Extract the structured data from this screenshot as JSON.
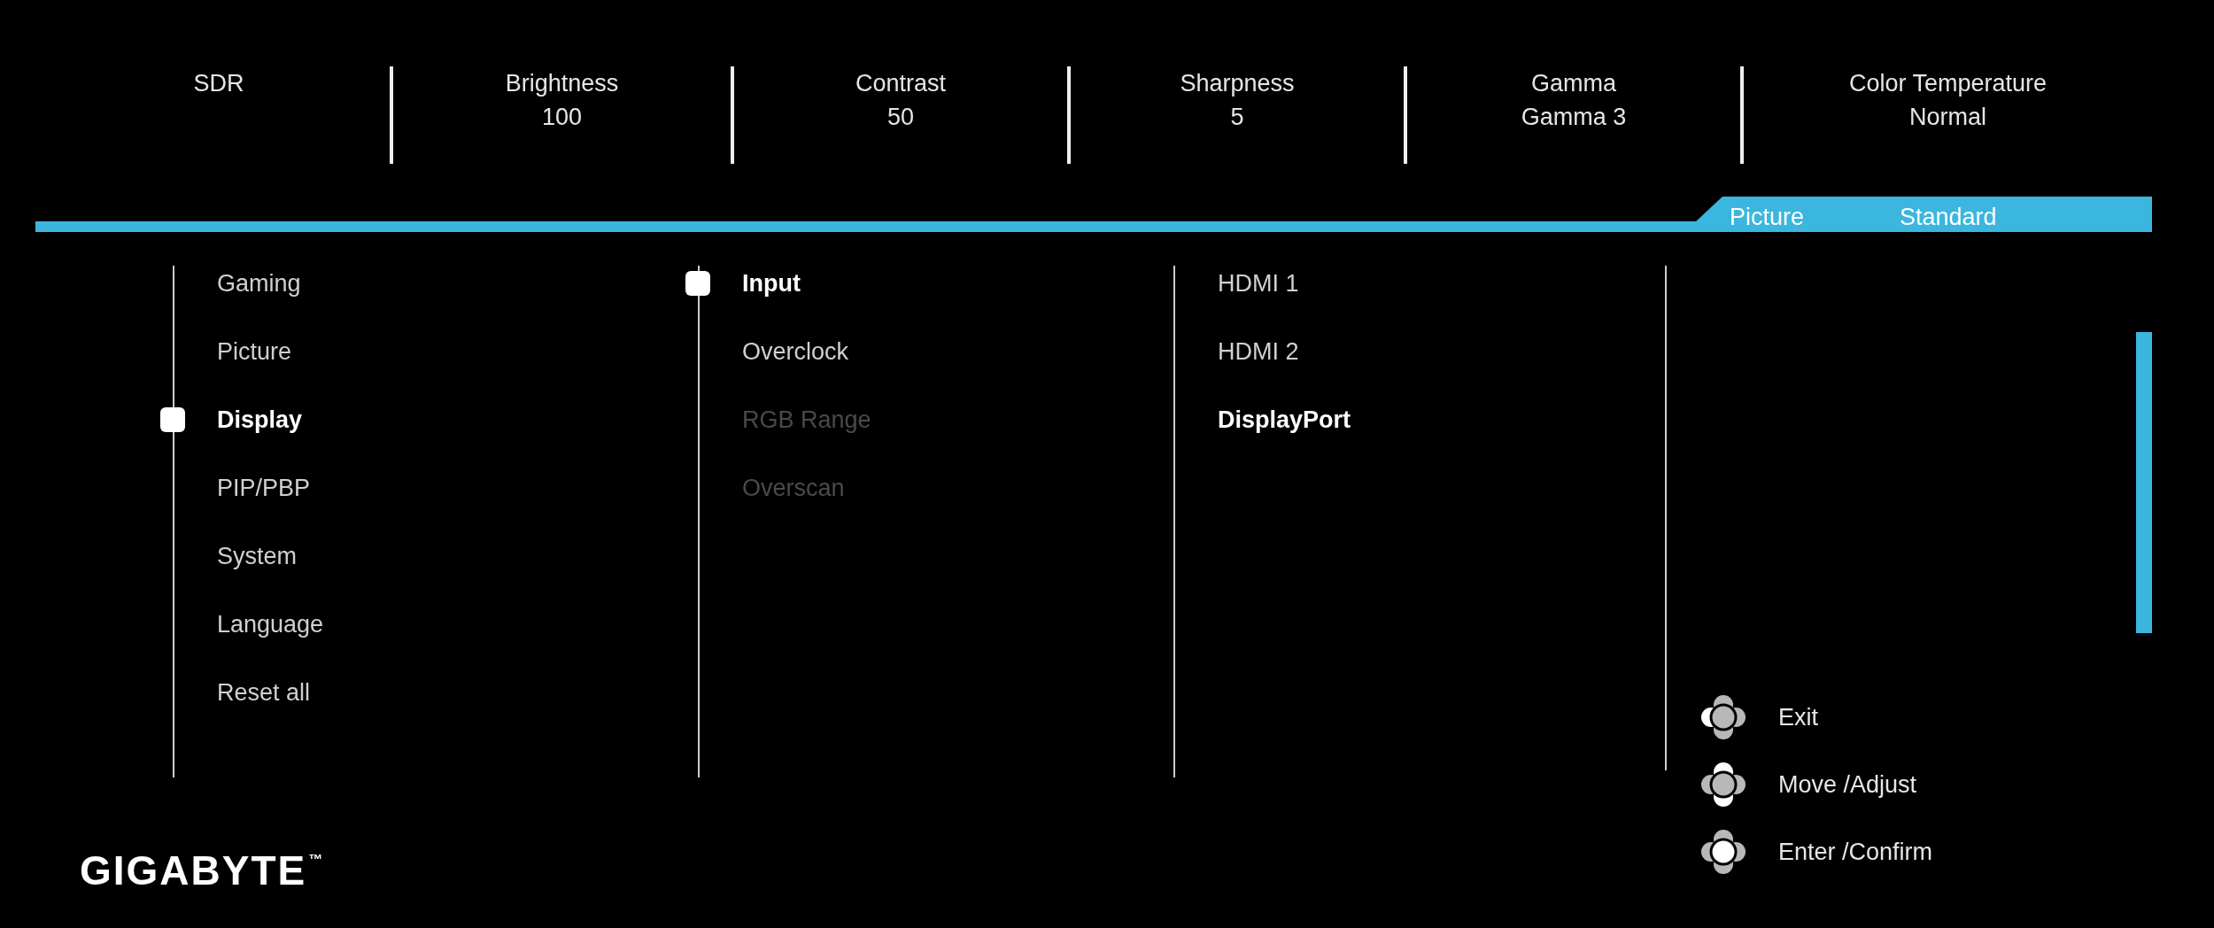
{
  "top_bar": [
    {
      "label": "SDR"
    },
    {
      "label": "Brightness",
      "value": "100"
    },
    {
      "label": "Contrast",
      "value": "50"
    },
    {
      "label": "Sharpness",
      "value": "5"
    },
    {
      "label": "Gamma",
      "value": "Gamma 3"
    },
    {
      "label": "Color Temperature",
      "value": "Normal"
    }
  ],
  "breadcrumb": {
    "category": "Picture",
    "mode": "Standard"
  },
  "main_menu": [
    {
      "label": "Gaming",
      "selected": false
    },
    {
      "label": "Picture",
      "selected": false
    },
    {
      "label": "Display",
      "selected": true
    },
    {
      "label": "PIP/PBP",
      "selected": false
    },
    {
      "label": "System",
      "selected": false
    },
    {
      "label": "Language",
      "selected": false
    },
    {
      "label": "Reset all",
      "selected": false
    }
  ],
  "submenu": [
    {
      "label": "Input",
      "selected": true,
      "disabled": false
    },
    {
      "label": "Overclock",
      "selected": false,
      "disabled": false
    },
    {
      "label": "RGB Range",
      "selected": false,
      "disabled": true
    },
    {
      "label": "Overscan",
      "selected": false,
      "disabled": true
    }
  ],
  "options": [
    {
      "label": "HDMI 1",
      "selected": false
    },
    {
      "label": "HDMI 2",
      "selected": false
    },
    {
      "label": "DisplayPort",
      "selected": true
    }
  ],
  "hints": [
    {
      "kind": "exit",
      "label": "Exit"
    },
    {
      "kind": "move",
      "label": "Move /Adjust"
    },
    {
      "kind": "enter",
      "label": "Enter /Confirm"
    }
  ],
  "logo": {
    "text": "GIGABYTE",
    "mark": "™"
  }
}
